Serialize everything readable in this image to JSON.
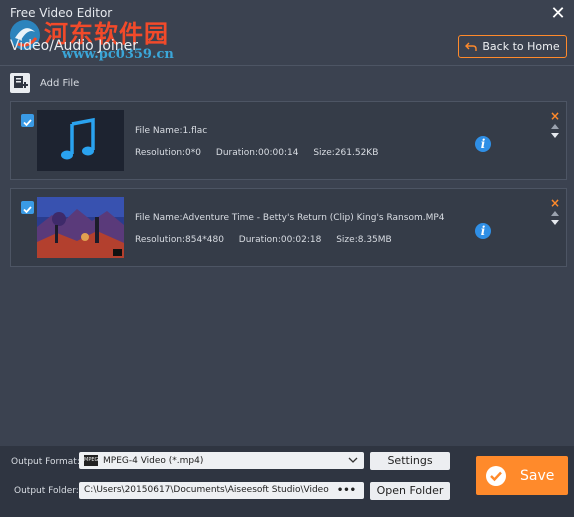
{
  "window": {
    "title": "Free Video Editor",
    "close_label": "✕"
  },
  "watermark": {
    "line1": "河东软件园",
    "line2": "www.pc0359.cn"
  },
  "header": {
    "page_title": "Video/Audio Joiner",
    "back_label": "Back to Home"
  },
  "toolbar": {
    "add_file_label": "Add File"
  },
  "files": [
    {
      "checked": true,
      "file_name": "File Name:1.flac",
      "resolution": "Resolution:0*0",
      "duration": "Duration:00:00:14",
      "size": "Size:261.52KB",
      "thumbnail": "music-note-icon"
    },
    {
      "checked": true,
      "file_name": "File Name:Adventure Time - Betty's Return (Clip) King's Ransom.MP4",
      "resolution": "Resolution:854*480",
      "duration": "Duration:00:02:18",
      "size": "Size:8.35MB",
      "thumbnail": "video-frame"
    }
  ],
  "row_controls": {
    "info_glyph": "i",
    "remove_glyph": "×"
  },
  "output": {
    "format_label": "Output Format:",
    "format_value": "MPEG-4 Video (*.mp4)",
    "format_icon_text": "MPEG",
    "settings_label": "Settings",
    "folder_label": "Output Folder:",
    "folder_value": "C:\\Users\\20150617\\Documents\\Aiseesoft Studio\\Video",
    "browse_label": "•••",
    "open_folder_label": "Open Folder",
    "save_label": "Save"
  },
  "colors": {
    "accent": "#ff8a2b",
    "check": "#3a9be6",
    "info": "#2f8fe6",
    "background": "#3b4250"
  }
}
